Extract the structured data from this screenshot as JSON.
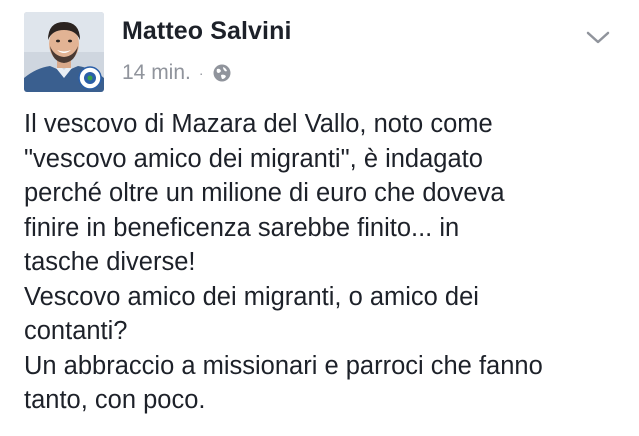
{
  "post": {
    "author": "Matteo Salvini",
    "timestamp": "14 min.",
    "separator": "·",
    "privacy_icon": "globe-icon",
    "menu_icon": "chevron-down-icon",
    "lines": [
      "Il vescovo di Mazara del Vallo, noto come",
      "\"vescovo amico dei migranti\", è indagato",
      "perché oltre un milione di euro che doveva",
      "finire in beneficenza sarebbe finito... in",
      "tasche diverse!",
      "Vescovo amico dei migranti, o amico dei",
      "contanti?",
      "Un abbraccio a missionari e parroci che fanno",
      "tanto, con poco."
    ]
  },
  "colors": {
    "text": "#1d2129",
    "meta": "#90949c",
    "background": "#ffffff"
  }
}
